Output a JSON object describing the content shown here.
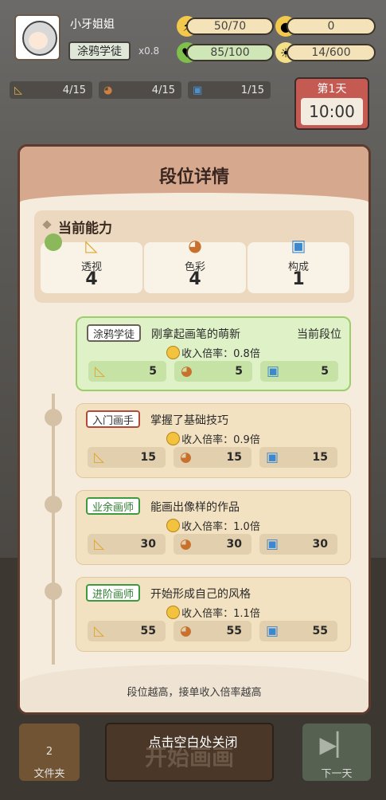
{
  "hud": {
    "player_name": "小牙姐姐",
    "rank": "涂鸦学徒",
    "multiplier": "x0.8",
    "energy": "50/70",
    "coins": "0",
    "mood": "85/100",
    "ideas": "14/600"
  },
  "tools": {
    "perspective": "4/15",
    "color": "4/15",
    "composition": "1/15"
  },
  "day": {
    "label": "第1天",
    "time": "10:00"
  },
  "modal": {
    "title": "段位详情",
    "ability": {
      "label": "当前能力",
      "items": [
        {
          "name": "透视",
          "value": "4",
          "icon": "triangle-ruler-icon"
        },
        {
          "name": "色彩",
          "value": "4",
          "icon": "palette-icon"
        },
        {
          "name": "构成",
          "value": "1",
          "icon": "camera-icon"
        }
      ]
    },
    "ranks": [
      {
        "tag": "涂鸦学徒",
        "desc": "刚拿起画笔的萌新",
        "current_label": "当前段位",
        "income": "收入倍率：0.8倍",
        "req": [
          "5",
          "5",
          "5"
        ]
      },
      {
        "tag": "入门画手",
        "desc": "掌握了基础技巧",
        "current_label": "",
        "income": "收入倍率：0.9倍",
        "req": [
          "15",
          "15",
          "15"
        ]
      },
      {
        "tag": "业余画师",
        "desc": "能画出像样的作品",
        "current_label": "",
        "income": "收入倍率：1.0倍",
        "req": [
          "30",
          "30",
          "30"
        ]
      },
      {
        "tag": "进阶画师",
        "desc": "开始形成自己的风格",
        "current_label": "",
        "income": "收入倍率：1.1倍",
        "req": [
          "55",
          "55",
          "55"
        ]
      }
    ],
    "footer": "段位越高，接单收入倍率越高"
  },
  "bottom": {
    "folder_count": "2",
    "folder_label": "文件夹",
    "start_label": "开始画画",
    "close_hint": "点击空白处关闭",
    "next_label": "下一天"
  },
  "colors": {
    "current_rank_bg": "#dff1c7",
    "modal_header": "#d6a88e",
    "modal_border": "#5e3b2c"
  }
}
